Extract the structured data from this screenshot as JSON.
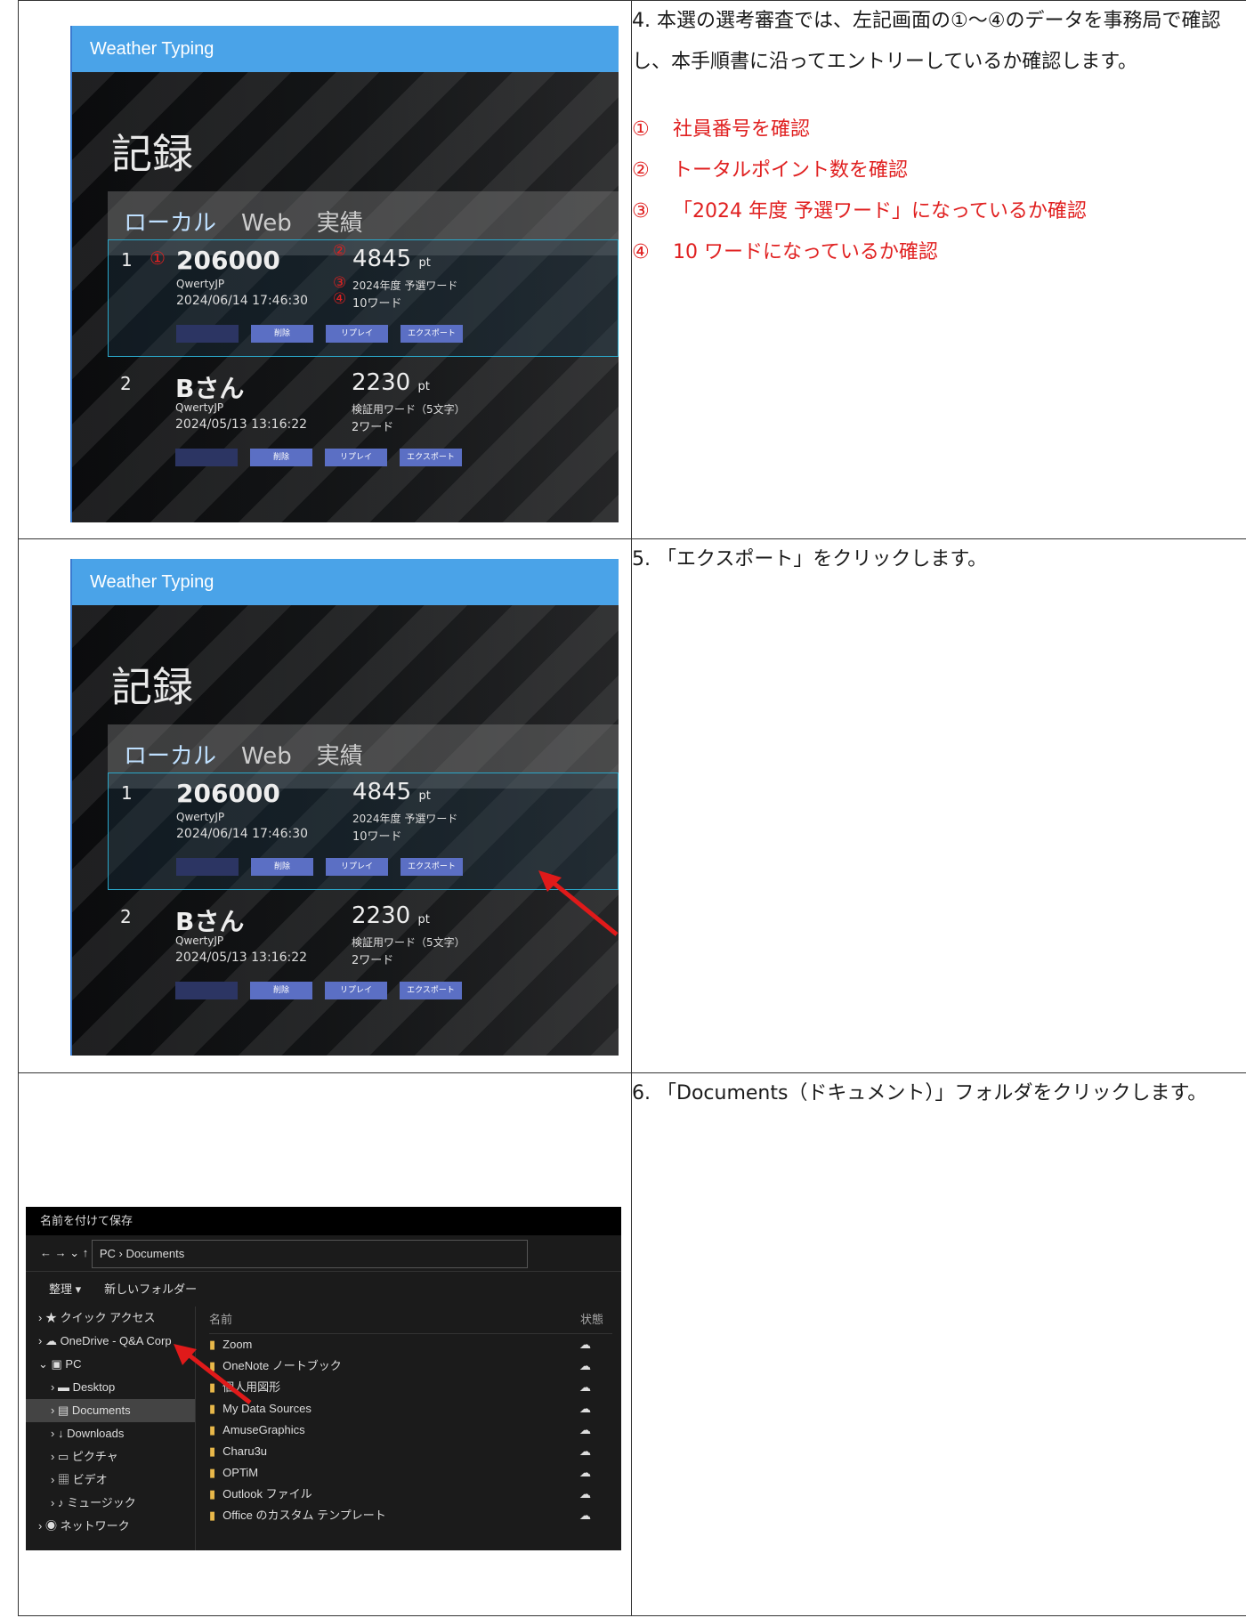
{
  "rows": [
    {
      "app": {
        "title": "Weather Typing",
        "heading": "記録",
        "tabs": [
          "ローカル",
          "Web",
          "実績"
        ],
        "entries": [
          {
            "rank": "1",
            "name": "206000",
            "user": "QwertyJP",
            "date": "2024/06/14 17:46:30",
            "points": "4845",
            "unit": "pt",
            "wordset": "2024年度 予選ワード",
            "words": "10ワード"
          },
          {
            "rank": "2",
            "name": "Bさん",
            "user": "QwertyJP",
            "date": "2024/05/13 13:16:22",
            "points": "2230",
            "unit": "pt",
            "wordset": "検証用ワード（5文字）",
            "words": "2ワード"
          }
        ],
        "buttons": [
          "削除",
          "リプレイ",
          "エクスポート"
        ],
        "markers": [
          "①",
          "②",
          "③",
          "④"
        ]
      },
      "step": "4.",
      "text": "本選の選考審査では、左記画面の①～④のデータを事務局で確認し、本手順書に沿ってエントリーしているか確認します。",
      "checks": [
        {
          "n": "①",
          "t": "社員番号を確認"
        },
        {
          "n": "②",
          "t": "トータルポイント数を確認"
        },
        {
          "n": "③",
          "t": "「2024 年度 予選ワード」になっているか確認"
        },
        {
          "n": "④",
          "t": "10 ワードになっているか確認"
        }
      ]
    },
    {
      "step": "5.",
      "text": "「エクスポート」をクリックします。"
    },
    {
      "step": "6.",
      "text": "「Documents（ドキュメント）」フォルダをクリックします。",
      "explorer": {
        "title": "名前を付けて保存",
        "address": "PC › Documents",
        "toolbar": [
          "整理 ▾",
          "新しいフォルダー"
        ],
        "nav": [
          "クイック アクセス",
          "OneDrive - Q&A Corp",
          "PC",
          "Desktop",
          "Documents",
          "Downloads",
          "ピクチャ",
          "ビデオ",
          "ミュージック",
          "ネットワーク"
        ],
        "col_name": "名前",
        "col_status": "状態",
        "files": [
          "Zoom",
          "OneNote ノートブック",
          "個人用図形",
          "My Data Sources",
          "AmuseGraphics",
          "Charu3u",
          "OPTiM",
          "Outlook ファイル",
          "Office のカスタム テンプレート"
        ]
      }
    }
  ]
}
